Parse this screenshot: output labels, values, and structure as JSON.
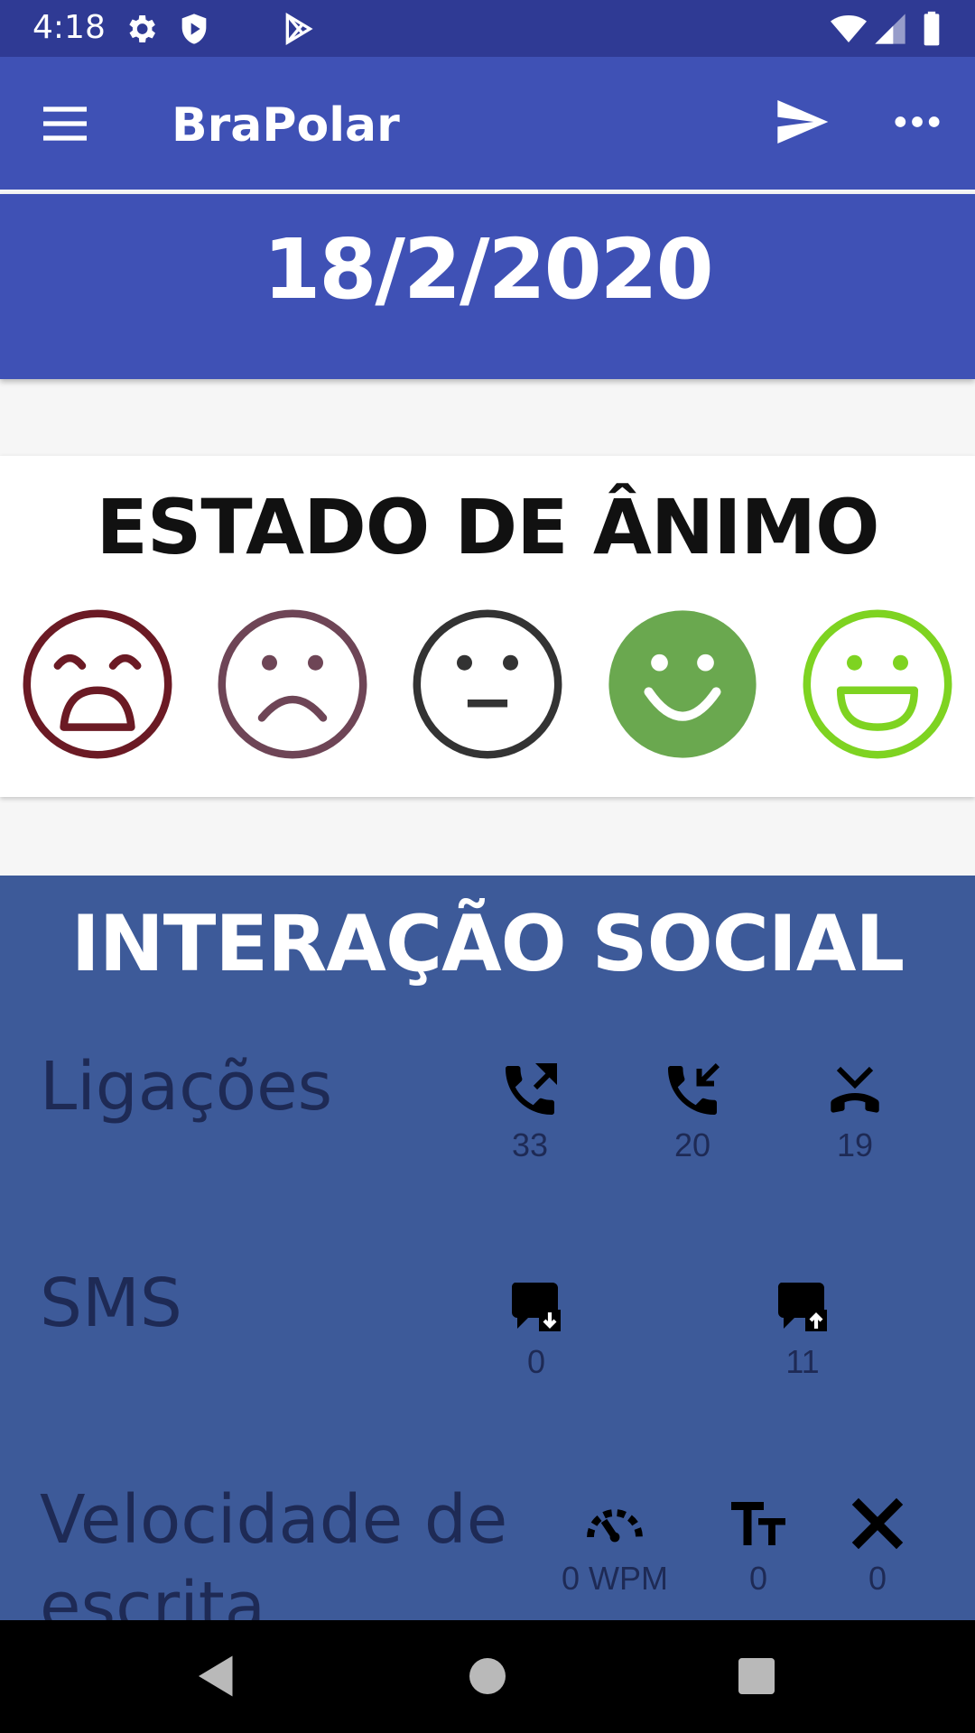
{
  "status_bar": {
    "time": "4:18",
    "icons": [
      "settings-icon",
      "shield-play-icon",
      "play-store-icon",
      "wifi-icon",
      "signal-icon",
      "battery-icon"
    ]
  },
  "app_bar": {
    "title": "BraPolar",
    "icons": [
      "menu-icon",
      "send-icon",
      "more-icon"
    ]
  },
  "date_card": {
    "date": "18/2/2020"
  },
  "mood": {
    "title": "ESTADO DE ÂNIMO",
    "faces": [
      {
        "name": "very-sad",
        "color": "#6b1a24"
      },
      {
        "name": "sad",
        "color": "#6e4556"
      },
      {
        "name": "neutral",
        "color": "#333333"
      },
      {
        "name": "happy",
        "color": "#6aa84f",
        "selected": true
      },
      {
        "name": "very-happy",
        "color": "#7ed321"
      }
    ]
  },
  "social": {
    "title": "INTERAÇÃO SOCIAL",
    "calls": {
      "label": "Ligações",
      "outgoing": "33",
      "incoming": "20",
      "missed": "19"
    },
    "sms": {
      "label": "SMS",
      "received": "0",
      "sent": "11"
    },
    "typing": {
      "label": "Velocidade de escrita",
      "speed": "0 WPM",
      "chars": "0",
      "errors": "0"
    }
  },
  "colors": {
    "status_bar": "#2f3a94",
    "primary": "#3f51b5",
    "social_bg": "#3d5a99"
  }
}
